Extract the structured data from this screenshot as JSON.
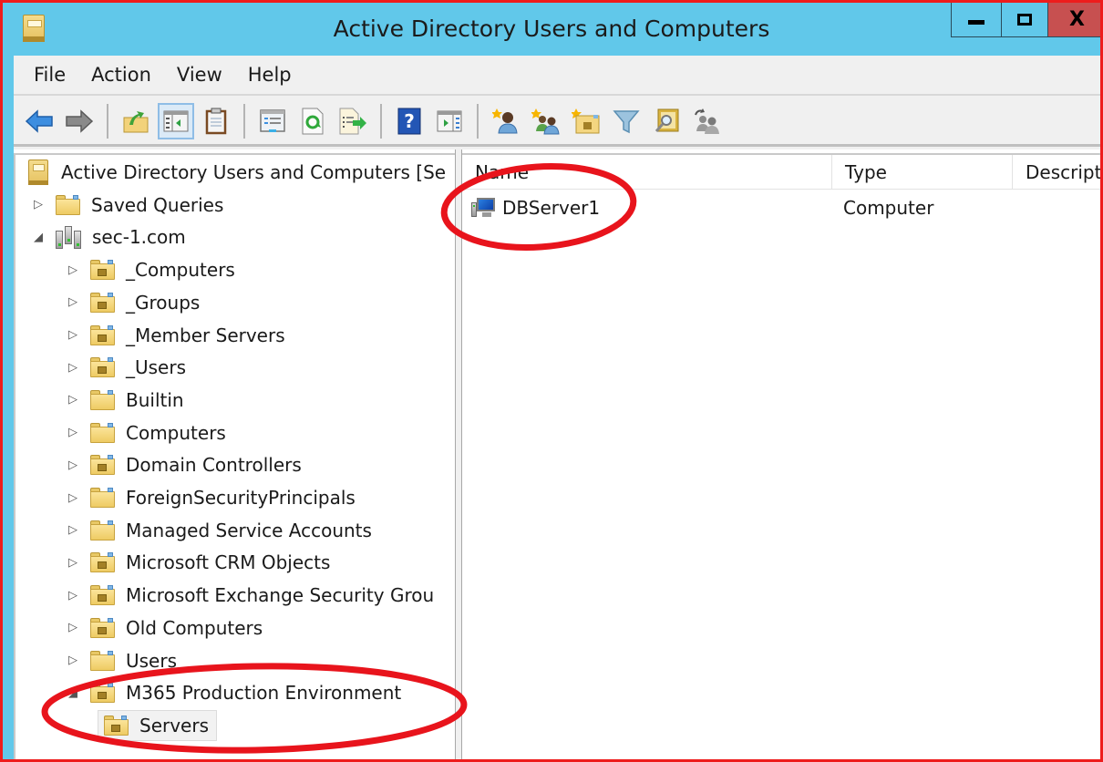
{
  "window": {
    "title": "Active Directory Users and Computers",
    "controls": {
      "minimize": "minimize",
      "maximize": "maximize",
      "close": "X"
    }
  },
  "menu": [
    "File",
    "Action",
    "View",
    "Help"
  ],
  "toolbar": {
    "buttons": [
      {
        "icon": "back-arrow-icon",
        "label": "Back"
      },
      {
        "icon": "forward-arrow-icon",
        "label": "Forward"
      },
      {
        "icon": "up-folder-icon",
        "label": "Up one level"
      },
      {
        "icon": "show-hide-tree-icon",
        "label": "Show/Hide Console Tree",
        "active": true
      },
      {
        "icon": "clipboard-icon",
        "label": "Paste"
      },
      {
        "icon": "properties-icon",
        "label": "Properties"
      },
      {
        "icon": "refresh-icon",
        "label": "Refresh"
      },
      {
        "icon": "export-list-icon",
        "label": "Export List"
      },
      {
        "icon": "help-icon",
        "label": "Help"
      },
      {
        "icon": "show-action-pane-icon",
        "label": "Show/Hide Action Pane"
      },
      {
        "icon": "new-user-icon",
        "label": "Create a new user"
      },
      {
        "icon": "new-group-icon",
        "label": "Create a new group"
      },
      {
        "icon": "new-ou-icon",
        "label": "Create a new organizational unit"
      },
      {
        "icon": "filter-icon",
        "label": "Filter"
      },
      {
        "icon": "find-icon",
        "label": "Find"
      },
      {
        "icon": "add-to-group-icon",
        "label": "Add to group"
      }
    ]
  },
  "tree": {
    "root": "Active Directory Users and Computers [Se",
    "items": [
      {
        "label": "Saved Queries",
        "level": 1,
        "expander": "collapsed",
        "icon": "folder"
      },
      {
        "label": "sec-1.com",
        "level": 1,
        "expander": "expanded",
        "icon": "domain"
      },
      {
        "label": "_Computers",
        "level": 2,
        "expander": "collapsed",
        "icon": "ou"
      },
      {
        "label": "_Groups",
        "level": 2,
        "expander": "collapsed",
        "icon": "ou"
      },
      {
        "label": "_Member Servers",
        "level": 2,
        "expander": "collapsed",
        "icon": "ou"
      },
      {
        "label": "_Users",
        "level": 2,
        "expander": "collapsed",
        "icon": "ou"
      },
      {
        "label": "Builtin",
        "level": 2,
        "expander": "collapsed",
        "icon": "folder"
      },
      {
        "label": "Computers",
        "level": 2,
        "expander": "collapsed",
        "icon": "folder"
      },
      {
        "label": "Domain Controllers",
        "level": 2,
        "expander": "collapsed",
        "icon": "ou"
      },
      {
        "label": "ForeignSecurityPrincipals",
        "level": 2,
        "expander": "collapsed",
        "icon": "folder"
      },
      {
        "label": "Managed Service Accounts",
        "level": 2,
        "expander": "collapsed",
        "icon": "folder"
      },
      {
        "label": "Microsoft CRM Objects",
        "level": 2,
        "expander": "collapsed",
        "icon": "ou"
      },
      {
        "label": "Microsoft Exchange Security Grou",
        "level": 2,
        "expander": "collapsed",
        "icon": "ou"
      },
      {
        "label": "Old Computers",
        "level": 2,
        "expander": "collapsed",
        "icon": "ou"
      },
      {
        "label": "Users",
        "level": 2,
        "expander": "collapsed",
        "icon": "folder"
      },
      {
        "label": "M365 Production Environment",
        "level": 2,
        "expander": "expanded",
        "icon": "ou"
      },
      {
        "label": "Servers",
        "level": 3,
        "expander": "none",
        "icon": "ou",
        "selected": true
      }
    ]
  },
  "list": {
    "columns": [
      "Name",
      "Type",
      "Descript"
    ],
    "rows": [
      {
        "name": "DBServer1",
        "type": "Computer",
        "description": "",
        "icon": "computer"
      }
    ]
  },
  "annotations": {
    "color": "#e8141c",
    "highlighted": [
      "DBServer1",
      "M365 Production Environment / Servers"
    ]
  }
}
